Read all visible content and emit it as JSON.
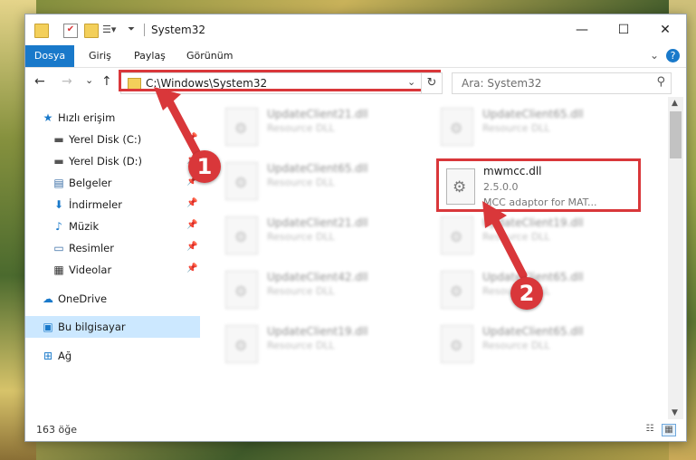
{
  "window": {
    "title": "System32",
    "controls": {
      "minimize": "—",
      "maximize": "☐",
      "close": "✕"
    }
  },
  "ribbon": {
    "tabs": [
      "Dosya",
      "Giriş",
      "Paylaş",
      "Görünüm"
    ],
    "chevron": "⌄",
    "help": "?"
  },
  "nav": {
    "back": "←",
    "forward": "→",
    "recent": "⌄",
    "up": "↑"
  },
  "address": {
    "path": "C:\\Windows\\System32",
    "dropdown": "⌄",
    "refresh": "↻"
  },
  "search": {
    "placeholder": "Ara: System32",
    "icon": "search-icon"
  },
  "sidebar": {
    "items": [
      {
        "label": "Hızlı erişim",
        "icon": "star-icon",
        "pinned": false
      },
      {
        "label": "Yerel Disk (C:)",
        "icon": "drive-icon",
        "pinned": true
      },
      {
        "label": "Yerel Disk (D:)",
        "icon": "drive-icon",
        "pinned": true
      },
      {
        "label": "Belgeler",
        "icon": "documents-icon",
        "pinned": true
      },
      {
        "label": "İndirmeler",
        "icon": "download-icon",
        "pinned": true
      },
      {
        "label": "Müzik",
        "icon": "music-icon",
        "pinned": true
      },
      {
        "label": "Resimler",
        "icon": "pictures-icon",
        "pinned": true
      },
      {
        "label": "Videolar",
        "icon": "videos-icon",
        "pinned": true
      },
      {
        "label": "OneDrive",
        "icon": "cloud-icon",
        "pinned": false
      },
      {
        "label": "Bu bilgisayar",
        "icon": "computer-icon",
        "pinned": false,
        "selected": true
      },
      {
        "label": "Ağ",
        "icon": "network-icon",
        "pinned": false
      }
    ]
  },
  "files": {
    "left_column": [
      {
        "name": "UpdateClient21.dll",
        "type": "Resource DLL"
      },
      {
        "name": "UpdateClient65.dll",
        "type": "Resource DLL"
      },
      {
        "name": "UpdateClient21.dll",
        "type": "Resource DLL"
      },
      {
        "name": "UpdateClient42.dll",
        "type": "Resource DLL"
      },
      {
        "name": "UpdateClient19.dll",
        "type": "Resource DLL"
      }
    ],
    "right_column": [
      {
        "name": "UpdateClient65.dll",
        "type": "Resource DLL"
      },
      {
        "name": "UpdateClient19.dll",
        "type": "Resource DLL"
      },
      {
        "name": "UpdateClient65.dll",
        "type": "Resource DLL"
      },
      {
        "name": "UpdateClient65.dll",
        "type": "Resource DLL"
      }
    ],
    "selected": {
      "name": "mwmcc.dll",
      "version": "2.5.0.0",
      "description": "MCC adaptor for MAT..."
    }
  },
  "status": {
    "item_count": "163 öğe"
  },
  "callouts": [
    "1",
    "2"
  ],
  "colors": {
    "accent": "#1979ca",
    "highlight": "#d9373a",
    "selected_bg": "#cce8ff"
  }
}
